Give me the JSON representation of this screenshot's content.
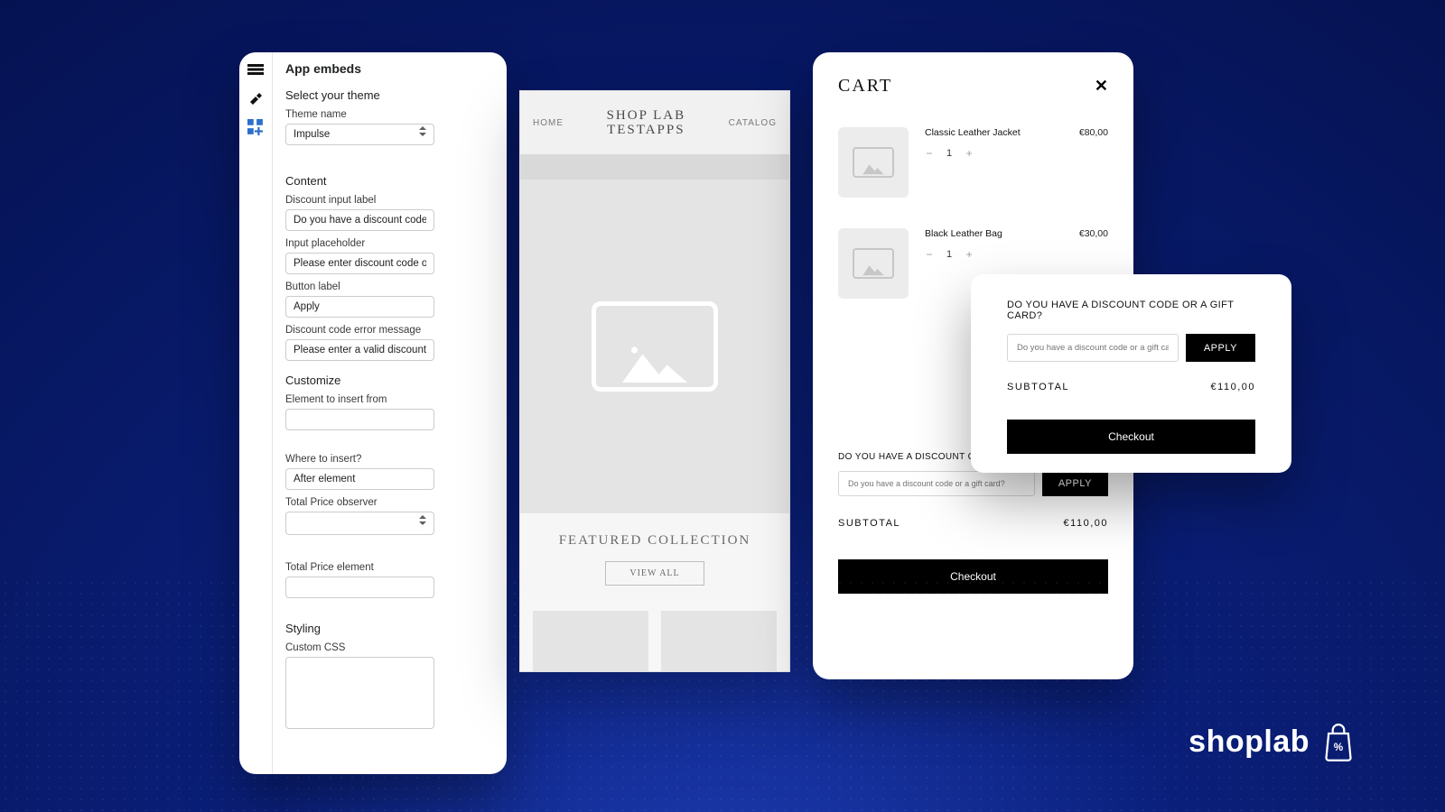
{
  "settings": {
    "title": "App embeds",
    "select_theme_label": "Select your theme",
    "theme_name_label": "Theme name",
    "theme_name_value": "Impulse",
    "content_heading": "Content",
    "discount_input_label_label": "Discount input label",
    "discount_input_label_value": "Do you have a discount code or gift ca",
    "input_placeholder_label": "Input placeholder",
    "input_placeholder_value": "Please enter discount code or gift card",
    "button_label_label": "Button label",
    "button_label_value": "Apply",
    "error_msg_label": "Discount code error message",
    "error_msg_value": "Please enter a valid discount code or gi",
    "customize_heading": "Customize",
    "element_insert_from_label": "Element to insert from",
    "where_insert_label": "Where to insert?",
    "where_insert_value": "After element",
    "total_price_observer_label": "Total Price observer",
    "total_price_element_label": "Total Price element",
    "styling_heading": "Styling",
    "custom_css_label": "Custom CSS"
  },
  "store": {
    "nav_home": "HOME",
    "nav_catalog": "CATALOG",
    "title_line1": "SHOP LAB",
    "title_line2": "TESTAPPS",
    "featured_heading": "FEATURED COLLECTION",
    "view_all": "VIEW ALL"
  },
  "cart": {
    "heading": "CART",
    "items": [
      {
        "name": "Classic Leather Jacket",
        "qty": "1",
        "price": "€80,00"
      },
      {
        "name": "Black Leather Bag",
        "qty": "1",
        "price": "€30,00"
      }
    ],
    "discount_prompt": "DO YOU HAVE A DISCOUNT CODE OR A GIFT CARD?",
    "discount_placeholder": "Do you have a discount code or a gift card?",
    "apply_label": "APPLY",
    "subtotal_label": "SUBTOTAL",
    "subtotal_value": "€110,00",
    "checkout_label": "Checkout"
  },
  "popup": {
    "discount_prompt": "DO YOU HAVE A DISCOUNT CODE OR A GIFT CARD?",
    "discount_placeholder": "Do you have a discount code or a gift card?",
    "apply_label": "APPLY",
    "subtotal_label": "SUBTOTAL",
    "subtotal_value": "€110,00",
    "checkout_label": "Checkout"
  },
  "brand": {
    "name": "shoplab"
  }
}
